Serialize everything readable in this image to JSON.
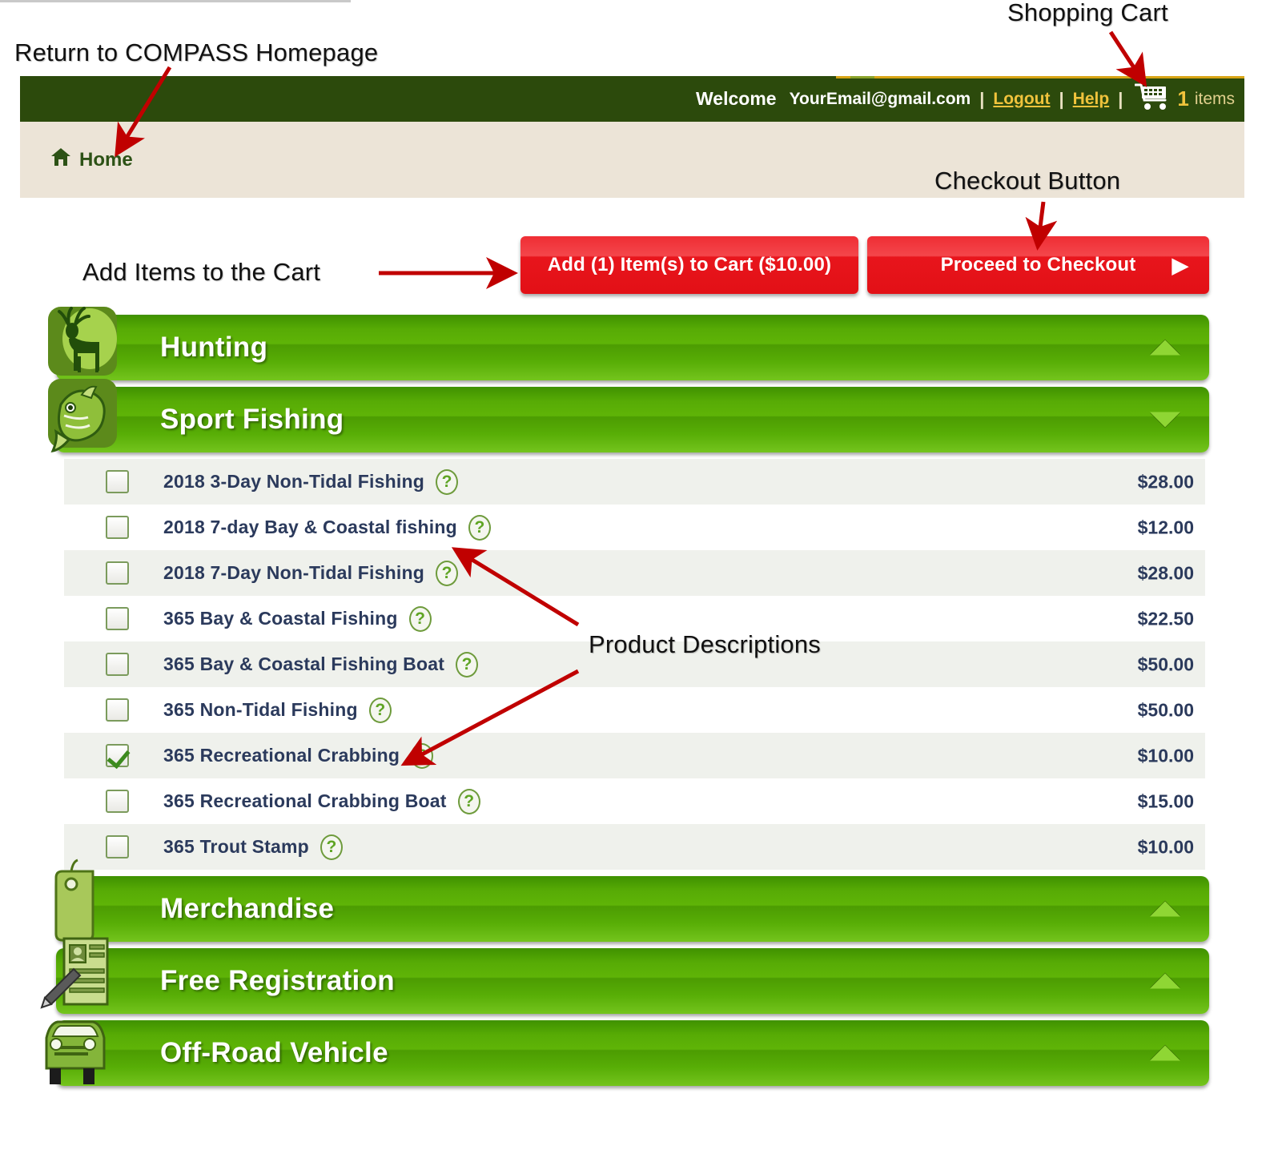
{
  "annotations": [
    {
      "id": "ann-homepage",
      "text": "Return to COMPASS Homepage"
    },
    {
      "id": "ann-cart",
      "text": "Shopping Cart"
    },
    {
      "id": "ann-checkout",
      "text": "Checkout Button"
    },
    {
      "id": "ann-additems",
      "text": "Add Items to the Cart"
    },
    {
      "id": "ann-descriptions",
      "text": "Product Descriptions"
    }
  ],
  "header": {
    "welcome_word": "Welcome",
    "email": "YourEmail@gmail.com",
    "separator": "|",
    "logout_label": "Logout",
    "help_label": "Help",
    "cart_icon": "shopping-cart-icon",
    "cart_count": "1",
    "cart_items_label": "items"
  },
  "breadcrumb": {
    "home_icon": "home-icon",
    "home_label": "Home"
  },
  "toolbar": {
    "add_to_cart_label": "Add (1) Item(s) to Cart ($10.00)",
    "checkout_label": "Proceed to Checkout",
    "checkout_chevron": "chevron-right-icon"
  },
  "categories": [
    {
      "name": "Hunting",
      "icon": "deer-icon",
      "state": "collapsed",
      "caret": "caret-up-icon"
    },
    {
      "name": "Sport Fishing",
      "icon": "fish-icon",
      "state": "expanded",
      "caret": "caret-down-icon"
    },
    {
      "name": "Merchandise",
      "icon": "price-tag-icon",
      "state": "collapsed",
      "caret": "caret-up-icon"
    },
    {
      "name": "Free Registration",
      "icon": "id-card-pencil-icon",
      "state": "collapsed",
      "caret": "caret-up-icon"
    },
    {
      "name": "Off-Road Vehicle",
      "icon": "off-road-truck-icon",
      "state": "collapsed",
      "caret": "caret-up-icon"
    }
  ],
  "products": [
    {
      "label": "2018 3-Day Non-Tidal Fishing",
      "price": "$28.00",
      "checked": false,
      "help": "?"
    },
    {
      "label": "2018 7-day Bay & Coastal fishing",
      "price": "$12.00",
      "checked": false,
      "help": "?"
    },
    {
      "label": "2018 7-Day Non-Tidal Fishing",
      "price": "$28.00",
      "checked": false,
      "help": "?"
    },
    {
      "label": "365 Bay & Coastal Fishing",
      "price": "$22.50",
      "checked": false,
      "help": "?"
    },
    {
      "label": "365 Bay & Coastal Fishing Boat",
      "price": "$50.00",
      "checked": false,
      "help": "?"
    },
    {
      "label": "365 Non-Tidal Fishing",
      "price": "$50.00",
      "checked": false,
      "help": "?"
    },
    {
      "label": "365 Recreational Crabbing",
      "price": "$10.00",
      "checked": true,
      "help": "?"
    },
    {
      "label": "365 Recreational Crabbing Boat",
      "price": "$15.00",
      "checked": false,
      "help": "?"
    },
    {
      "label": "365 Trout Stamp",
      "price": "$10.00",
      "checked": false,
      "help": "?"
    }
  ],
  "colors": {
    "header_green": "#2c4a0c",
    "breadcrumb_beige": "#ece4d7",
    "bar_green": "#57ab05",
    "button_red": "#ef2d34",
    "gold": "#f0c33c",
    "annotation_arrow_red": "#c00000",
    "row_alt": "#eff1ec"
  }
}
